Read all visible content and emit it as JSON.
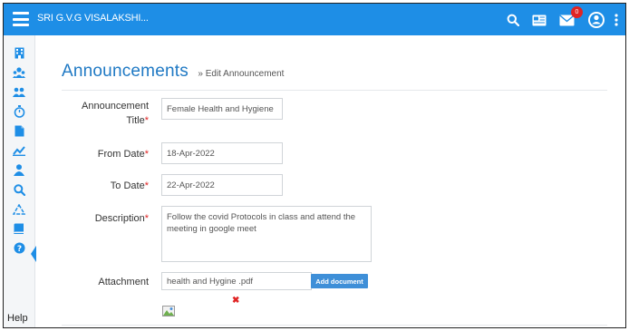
{
  "topbar": {
    "brand": "SRI G.V.G VISALAKSHI...",
    "badge_count": "0",
    "bg_color": "#1e8ee6"
  },
  "sidebar": {
    "items": [
      {
        "icon": "building-icon"
      },
      {
        "icon": "users-icon"
      },
      {
        "icon": "group-icon"
      },
      {
        "icon": "stopwatch-icon"
      },
      {
        "icon": "document-icon"
      },
      {
        "icon": "chart-icon"
      },
      {
        "icon": "user-icon"
      },
      {
        "icon": "search-icon"
      },
      {
        "icon": "recycle-icon"
      },
      {
        "icon": "book-icon"
      },
      {
        "icon": "question-icon"
      }
    ],
    "help_label": "Help"
  },
  "page": {
    "title": "Announcements",
    "subtitle": "» Edit Announcement"
  },
  "form": {
    "title_label_1": "Announcement",
    "title_label_2": "Title",
    "title_value": "Female Health and Hygiene",
    "from_label": "From Date",
    "from_value": "18-Apr-2022",
    "to_label": "To Date",
    "to_value": "22-Apr-2022",
    "description_label": "Description",
    "description_value": "Follow the covid Protocols in class and attend the meeting in google meet",
    "attachment_label": "Attachment",
    "attachment_value": "health and Hygine .pdf",
    "add_document_label": "Add document",
    "required_mark": "*",
    "remove_mark": "✖"
  }
}
